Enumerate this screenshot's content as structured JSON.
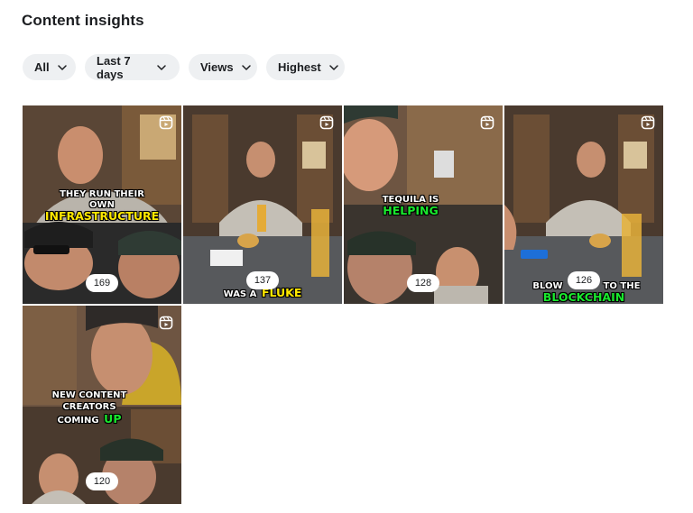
{
  "page": {
    "title": "Content insights"
  },
  "filters": [
    {
      "label": "All"
    },
    {
      "label": "Last 7 days"
    },
    {
      "label": "Views"
    },
    {
      "label": "Highest"
    }
  ],
  "icons": {
    "chevron": "chevron-down-icon",
    "reel": "reels-icon"
  },
  "colors": {
    "caption_yellow": "#ffe800",
    "caption_green": "#19e82d",
    "chip_bg": "#eef0f2"
  },
  "reels": [
    {
      "caption_top": "THEY RUN THEIR",
      "caption_mid": "OWN",
      "caption_hl": "INFRASTRUCTURE",
      "views": "169"
    },
    {
      "caption_top": "WAS A",
      "caption_hl": "FLUKE",
      "views": "137"
    },
    {
      "caption_top": "TEQUILA IS",
      "caption_hl": "HELPING",
      "views": "128"
    },
    {
      "caption_top": "BLOW",
      "caption_mid": "TO THE",
      "caption_hl": "BLOCKCHAIN",
      "views": "126"
    },
    {
      "caption_top": "NEW CONTENT",
      "caption_mid": "CREATORS",
      "caption_low": "COMING",
      "caption_hl": "UP",
      "views": "120"
    }
  ]
}
